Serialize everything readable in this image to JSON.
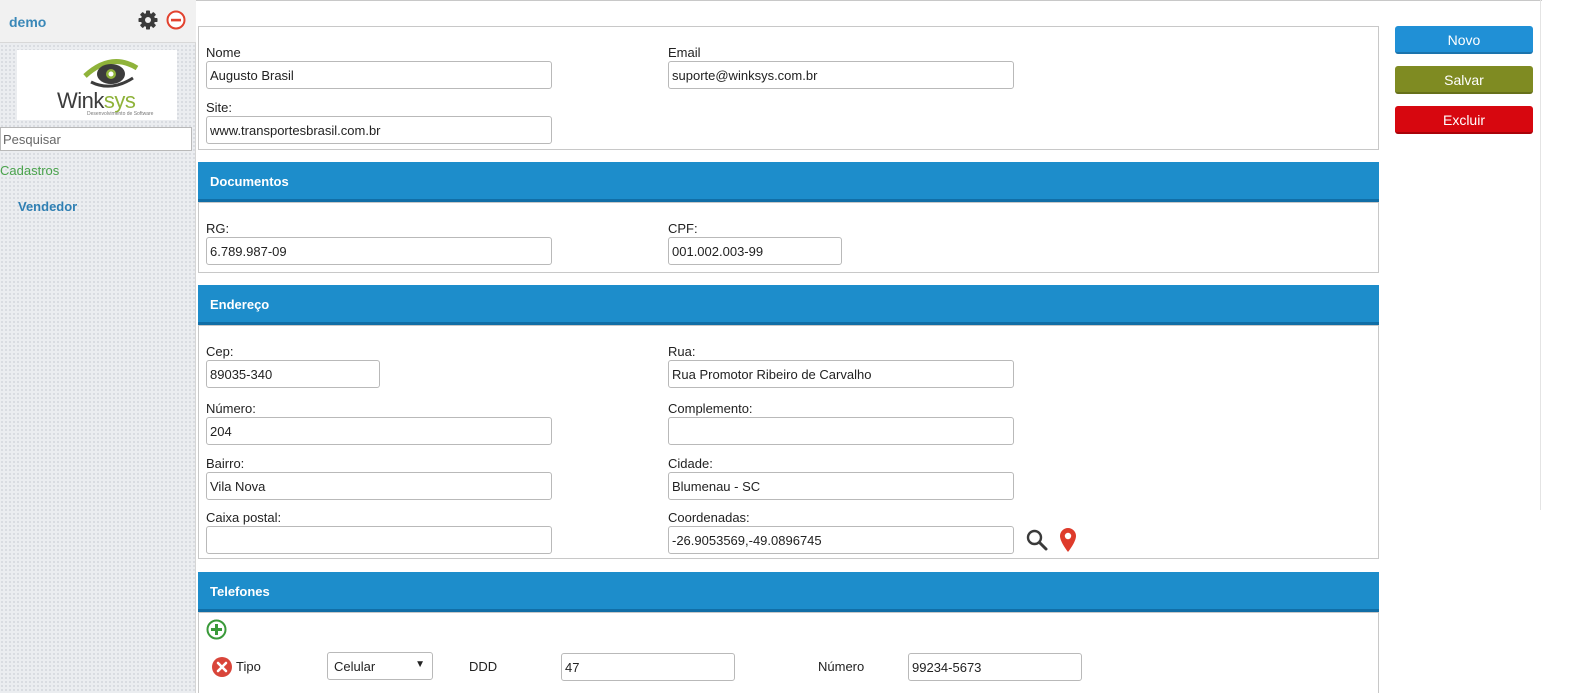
{
  "sidebar": {
    "user": "demo",
    "logo": {
      "brand_left": "Wink",
      "brand_right": "sys",
      "tagline": "Desenvolvimento de Software"
    },
    "search_placeholder": "Pesquisar",
    "section": "Cadastros",
    "item": "Vendedor"
  },
  "general": {
    "nome_label": "Nome",
    "nome_value": "Augusto Brasil",
    "email_label": "Email",
    "email_value": "suporte@winksys.com.br",
    "site_label": "Site:",
    "site_value": "www.transportesbrasil.com.br"
  },
  "documentos": {
    "title": "Documentos",
    "rg_label": "RG:",
    "rg_value": "6.789.987-09",
    "cpf_label": "CPF:",
    "cpf_value": "001.002.003-99"
  },
  "endereco": {
    "title": "Endereço",
    "cep_label": "Cep:",
    "cep_value": "89035-340",
    "rua_label": "Rua:",
    "rua_value": "Rua Promotor Ribeiro de Carvalho",
    "numero_label": "Número:",
    "numero_value": "204",
    "complemento_label": "Complemento:",
    "complemento_value": "",
    "bairro_label": "Bairro:",
    "bairro_value": "Vila Nova",
    "cidade_label": "Cidade:",
    "cidade_value": "Blumenau - SC",
    "caixa_label": "Caixa postal:",
    "caixa_value": "",
    "coord_label": "Coordenadas:",
    "coord_value": "-26.9053569,-49.0896745"
  },
  "telefones": {
    "title": "Telefones",
    "row": {
      "tipo_label": "Tipo",
      "tipo_value": "Celular",
      "ddd_label": "DDD",
      "ddd_value": "47",
      "numero_label": "Número",
      "numero_value": "99234-5673"
    }
  },
  "actions": {
    "novo": "Novo",
    "salvar": "Salvar",
    "excluir": "Excluir"
  },
  "colors": {
    "accent": "#1d8dcb",
    "novo": "#2090d6",
    "salvar": "#7f8b22",
    "excluir": "#d7070f"
  },
  "icons": [
    "gear-icon",
    "minus-circle-icon",
    "search-icon",
    "map-pin-icon",
    "add-icon",
    "remove-icon"
  ]
}
